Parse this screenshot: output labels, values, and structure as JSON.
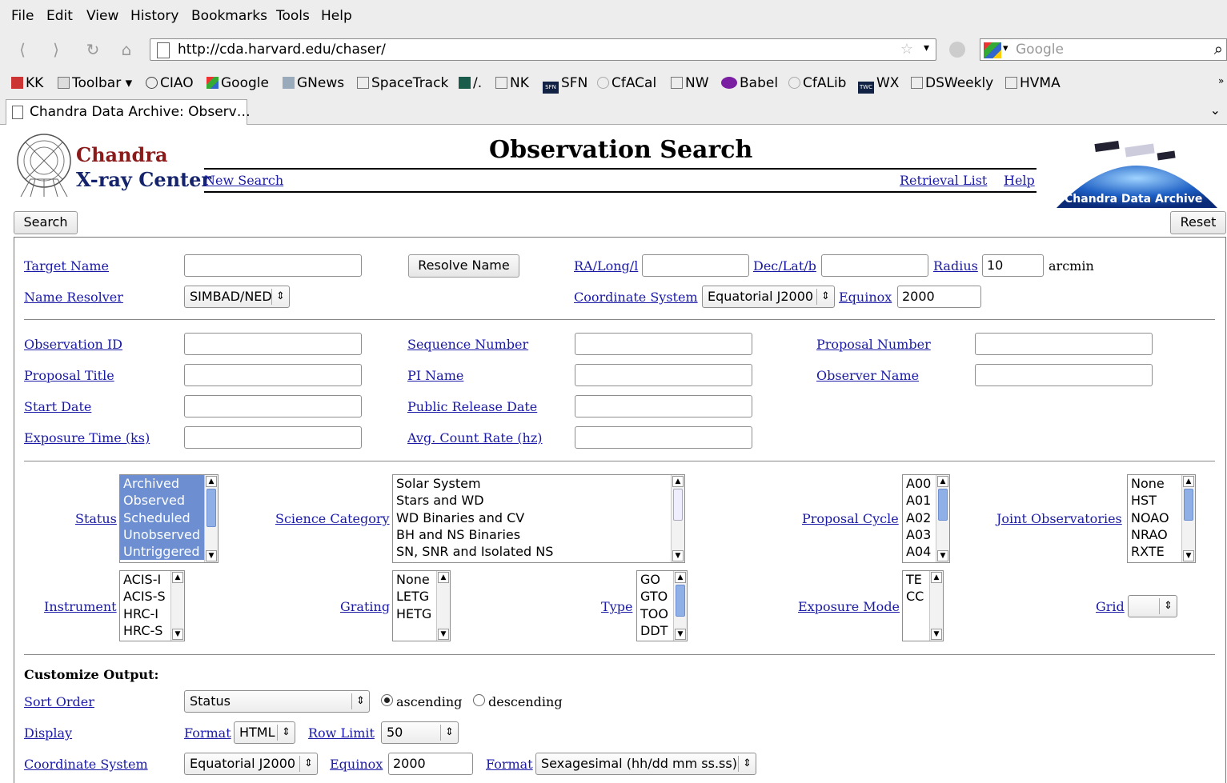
{
  "menu": [
    "File",
    "Edit",
    "View",
    "History",
    "Bookmarks",
    "Tools",
    "Help"
  ],
  "url": "http://cda.harvard.edu/chaser/",
  "search_placeholder": "Google",
  "bookmarks": [
    "KK",
    "Toolbar",
    "CIAO",
    "Google",
    "GNews",
    "SpaceTrack",
    "/.",
    "NK",
    "SFN",
    "CfACal",
    "NW",
    "Babel",
    "CfALib",
    "WX",
    "DSWeekly",
    "HVMA"
  ],
  "bookmark_badges": {
    "sfn": "SFN",
    "wx": "TWC"
  },
  "tab_title": "Chandra Data Archive: Observ…",
  "header": {
    "brand_line1": "Chandra",
    "brand_line2": "X-ray Center",
    "title": "Observation Search",
    "new_search": "New Search",
    "retrieval_list": "Retrieval List",
    "help": "Help",
    "badge": "Chandra Data Archive"
  },
  "buttons": {
    "search": "Search",
    "reset": "Reset",
    "resolve": "Resolve Name"
  },
  "fields": {
    "target_name": "Target Name",
    "ra": "RA/Long/l",
    "dec": "Dec/Lat/b",
    "radius": "Radius",
    "radius_value": "10",
    "arcmin": "arcmin",
    "name_resolver": "Name Resolver",
    "name_resolver_value": "SIMBAD/NED",
    "coord_system": "Coordinate System",
    "coord_system_value": "Equatorial J2000",
    "equinox": "Equinox",
    "equinox_value": "2000",
    "obs_id": "Observation ID",
    "seq_num": "Sequence Number",
    "prop_num": "Proposal Number",
    "prop_title": "Proposal Title",
    "pi_name": "PI Name",
    "observer": "Observer Name",
    "start_date": "Start Date",
    "release_date": "Public Release Date",
    "exposure": "Exposure Time (ks)",
    "count_rate": "Avg. Count Rate (hz)"
  },
  "lists": {
    "status_label": "Status",
    "status": [
      "Archived",
      "Observed",
      "Scheduled",
      "Unobserved",
      "Untriggered"
    ],
    "science_label": "Science Category",
    "science": [
      "Solar System",
      "Stars and WD",
      "WD Binaries and CV",
      "BH and NS Binaries",
      "SN, SNR and Isolated NS"
    ],
    "cycle_label": "Proposal Cycle",
    "cycle": [
      "A00",
      "A01",
      "A02",
      "A03",
      "A04"
    ],
    "joint_label": "Joint Observatories",
    "joint": [
      "None",
      "HST",
      "NOAO",
      "NRAO",
      "RXTE"
    ],
    "instrument_label": "Instrument",
    "instrument": [
      "ACIS-I",
      "ACIS-S",
      "HRC-I",
      "HRC-S"
    ],
    "grating_label": "Grating",
    "grating": [
      "None",
      "LETG",
      "HETG"
    ],
    "type_label": "Type",
    "type": [
      "GO",
      "GTO",
      "TOO",
      "DDT"
    ],
    "exp_mode_label": "Exposure Mode",
    "exp_mode": [
      "TE",
      "CC"
    ],
    "grid_label": "Grid"
  },
  "output": {
    "heading": "Customize Output:",
    "sort_order": "Sort Order",
    "sort_value": "Status",
    "ascending": "ascending",
    "descending": "descending",
    "display": "Display",
    "format": "Format",
    "format_value": "HTML",
    "row_limit": "Row Limit",
    "row_limit_value": "50",
    "coord_system": "Coordinate System",
    "coord_value": "Equatorial J2000",
    "equinox": "Equinox",
    "equinox_value": "2000",
    "format2": "Format",
    "format2_value": "Sexagesimal (hh/dd mm ss.ss)"
  }
}
